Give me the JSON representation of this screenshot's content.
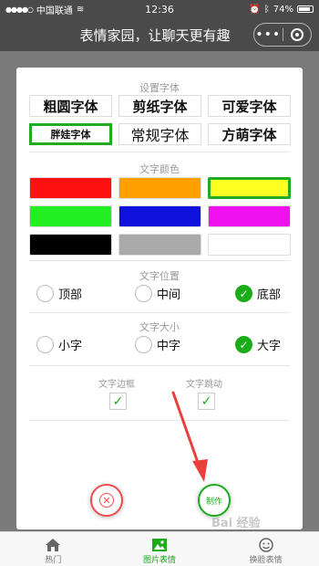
{
  "status_bar": {
    "carrier": "中国联通",
    "time": "12:36",
    "battery": "74%"
  },
  "nav": {
    "title": "表情家园，让聊天更有趣",
    "more_icon": "more-dots-icon",
    "close_icon": "target-icon"
  },
  "font_section": {
    "title": "设置字体",
    "options": [
      "粗圆字体",
      "剪纸字体",
      "可爱字体",
      "胖娃字体",
      "常规字体",
      "方萌字体"
    ],
    "selected": "胖娃字体"
  },
  "color_section": {
    "title": "文字颜色",
    "colors": [
      "#ff1111",
      "#ff9f00",
      "#ffff22",
      "#22ee22",
      "#1111dd",
      "#ee11ee",
      "#000000",
      "#aaaaaa",
      "#ffffff"
    ],
    "selected": "#ffff22"
  },
  "position_section": {
    "title": "文字位置",
    "options": [
      "顶部",
      "中间",
      "底部"
    ],
    "selected": "底部"
  },
  "size_section": {
    "title": "文字大小",
    "options": [
      "小字",
      "中字",
      "大字"
    ],
    "selected": "大字"
  },
  "toggles": {
    "border_label": "文字边框",
    "border_checked": true,
    "animate_label": "文字跳动",
    "animate_checked": true
  },
  "actions": {
    "cancel_icon": "close-circle-icon",
    "make_label": "制作"
  },
  "tabs": [
    {
      "label": "热门",
      "icon": "home-icon",
      "active": false
    },
    {
      "label": "图片表情",
      "icon": "image-icon",
      "active": true
    },
    {
      "label": "换脸表情",
      "icon": "face-icon",
      "active": false
    }
  ],
  "accent_color": "#1aad19"
}
